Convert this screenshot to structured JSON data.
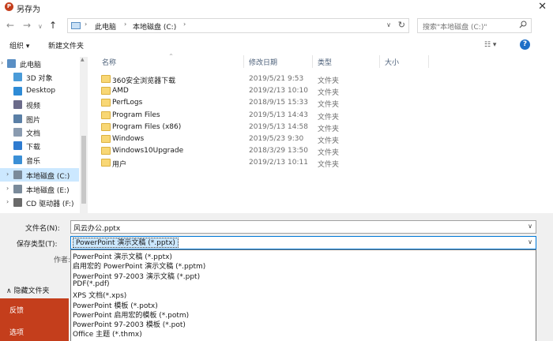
{
  "window": {
    "title": "另存为",
    "app_icon_letter": "P"
  },
  "address": {
    "crumbs": [
      "此电脑",
      "本地磁盘 (C:)"
    ]
  },
  "search": {
    "placeholder": "搜索\"本地磁盘 (C:)\""
  },
  "toolbar": {
    "organize_label": "组织 ▾",
    "new_folder_label": "新建文件夹"
  },
  "sidebar": {
    "items": [
      {
        "label": "此电脑",
        "icon": "computer-icon",
        "color": "#5a8fc4"
      },
      {
        "label": "3D 对象",
        "icon": "3d-objects-icon",
        "color": "#4a9bd8"
      },
      {
        "label": "Desktop",
        "icon": "desktop-icon",
        "color": "#2e8bd6"
      },
      {
        "label": "视频",
        "icon": "video-icon",
        "color": "#6b6b8a"
      },
      {
        "label": "图片",
        "icon": "pictures-icon",
        "color": "#5a7fa6"
      },
      {
        "label": "文档",
        "icon": "documents-icon",
        "color": "#8a9bb0"
      },
      {
        "label": "下载",
        "icon": "downloads-icon",
        "color": "#2e7bd0"
      },
      {
        "label": "音乐",
        "icon": "music-icon",
        "color": "#3a8fd6"
      },
      {
        "label": "本地磁盘 (C:)",
        "icon": "drive-c-icon",
        "color": "#7a8a9a"
      },
      {
        "label": "本地磁盘 (E:)",
        "icon": "drive-e-icon",
        "color": "#7a8a9a"
      },
      {
        "label": "CD 驱动器 (F:)",
        "icon": "cd-drive-icon",
        "color": "#6a6a6a"
      }
    ],
    "selected_index": 8
  },
  "filelist": {
    "columns": [
      "名称",
      "修改日期",
      "类型",
      "大小"
    ],
    "rows": [
      {
        "name": "360安全浏览器下载",
        "date": "2019/5/21 9:53",
        "type": "文件夹"
      },
      {
        "name": "AMD",
        "date": "2019/2/13 10:10",
        "type": "文件夹"
      },
      {
        "name": "PerfLogs",
        "date": "2018/9/15 15:33",
        "type": "文件夹"
      },
      {
        "name": "Program Files",
        "date": "2019/5/13 14:43",
        "type": "文件夹"
      },
      {
        "name": "Program Files (x86)",
        "date": "2019/5/13 14:58",
        "type": "文件夹"
      },
      {
        "name": "Windows",
        "date": "2019/5/23 9:30",
        "type": "文件夹"
      },
      {
        "name": "Windows10Upgrade",
        "date": "2018/3/29 13:50",
        "type": "文件夹"
      },
      {
        "name": "用户",
        "date": "2019/2/13 10:11",
        "type": "文件夹"
      }
    ]
  },
  "form": {
    "filename_label": "文件名(N):",
    "filename_value": "风云办公.pptx",
    "filetype_label": "保存类型(T):",
    "filetype_value": "PowerPoint 演示文稿 (*.pptx)",
    "authors_label": "作者:"
  },
  "filetype_options": [
    "PowerPoint 演示文稿 (*.pptx)",
    "启用宏的 PowerPoint 演示文稿 (*.pptm)",
    "PowerPoint 97-2003 演示文稿 (*.ppt)",
    "PDF(*.pdf)",
    "XPS 文档(*.xps)",
    "PowerPoint 模板 (*.potx)",
    "PowerPoint 启用宏的模板 (*.potm)",
    "PowerPoint 97-2003 模板 (*.pot)",
    "Office 主题 (*.thmx)"
  ],
  "hide_folders_label": "隐藏文件夹",
  "backstage": {
    "items": [
      "反馈",
      "选项"
    ],
    "color": "#c43e1c"
  }
}
